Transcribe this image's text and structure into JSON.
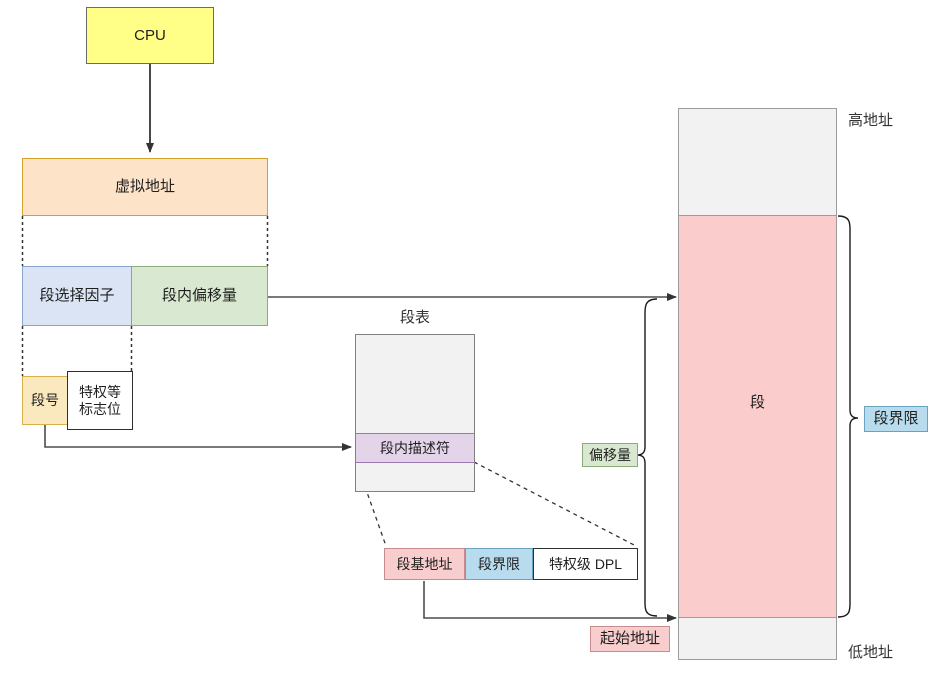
{
  "diagram": {
    "title_note": "x86 segmentation address translation diagram",
    "colors": {
      "cpu_fill": "#ffff88",
      "cpu_stroke": "#6b6b6b",
      "virtual_addr_fill": "#fde4c8",
      "virtual_addr_stroke": "#d6a029",
      "selector_fill": "#dae4f5",
      "selector_stroke": "#8aa4cc",
      "offset_fill": "#d9e8d0",
      "offset_stroke": "#8bab79",
      "segnum_fill": "#fae9bf",
      "segnum_stroke": "#d6b14a",
      "plain_fill": "#ffffff",
      "plain_stroke": "#3d3d3d",
      "table_fill": "#f2f2f2",
      "table_stroke": "#808080",
      "descriptor_fill": "#e3d4ea",
      "descriptor_stroke": "#9a78ae",
      "base_fill": "#f8cdcd",
      "base_stroke": "#c98c8c",
      "limit_fill": "#b8dcee",
      "limit_stroke": "#6aa3bf",
      "segment_fill": "#fbcccc",
      "segment_stroke": "#9c9c9c",
      "memory_fill": "#f2f2f2",
      "memory_stroke": "#9c9c9c",
      "line": "#4d4d4d",
      "text": "#1f1f1f"
    },
    "nodes": {
      "cpu": "CPU",
      "virtual_address": "虚拟地址",
      "segment_selector": "段选择因子",
      "in_segment_offset": "段内偏移量",
      "segment_number": "段号",
      "privilege_flag": "特权等\n标志位",
      "segment_table_title": "段表",
      "segment_descriptor": "段内描述符",
      "descriptor_base": "段基地址",
      "descriptor_limit": "段界限",
      "descriptor_dpl": "特权级 DPL",
      "memory_segment": "段"
    },
    "annotations": {
      "high_address": "高地址",
      "low_address": "低地址",
      "offset_brace": "偏移量",
      "limit_brace": "段界限",
      "start_address": "起始地址"
    }
  }
}
